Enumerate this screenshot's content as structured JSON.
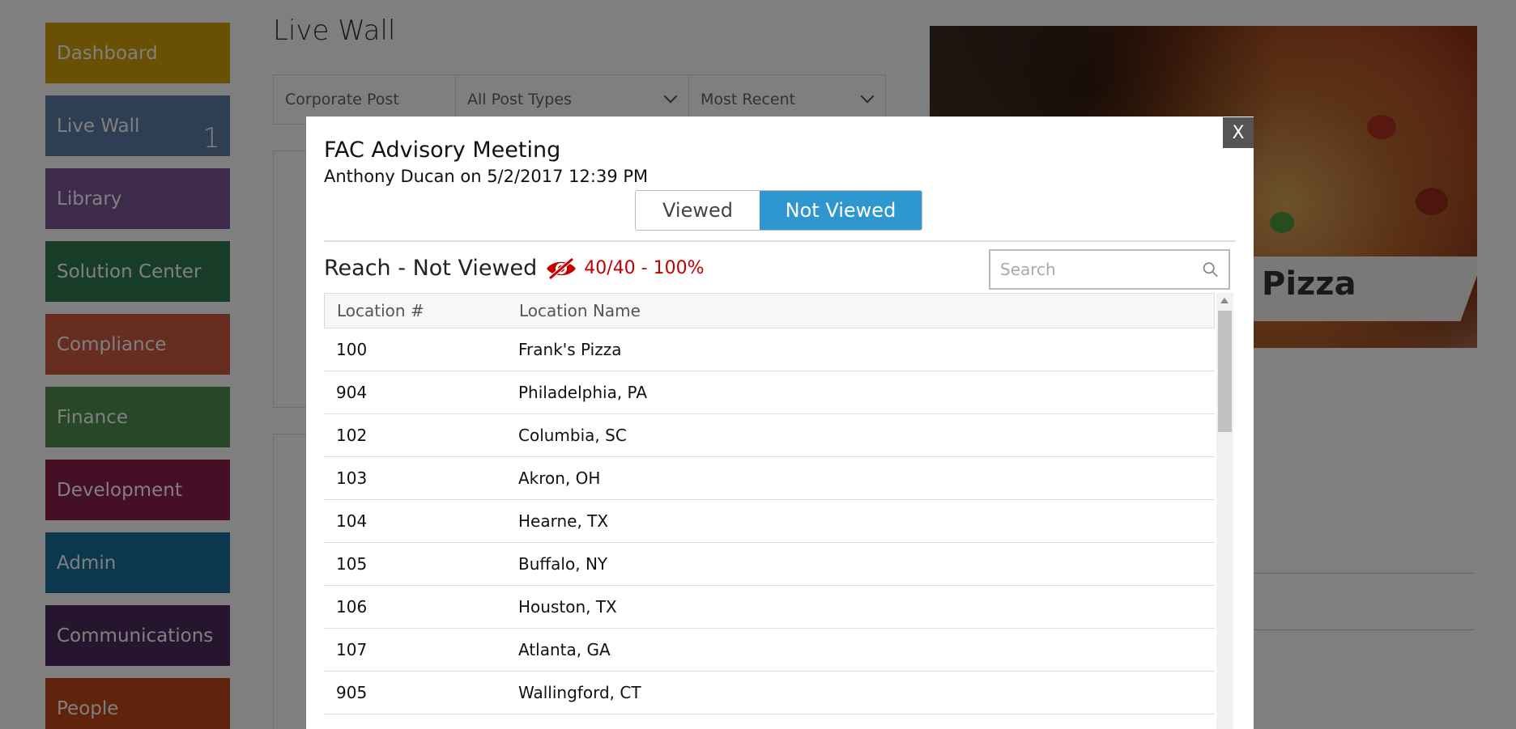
{
  "sidebar": {
    "items": [
      {
        "label": "Dashboard",
        "color": "#d4a10a"
      },
      {
        "label": "Live Wall",
        "color": "#5c7ea6",
        "count": "1"
      },
      {
        "label": "Library",
        "color": "#7d5596"
      },
      {
        "label": "Solution Center",
        "color": "#2f7a52"
      },
      {
        "label": "Compliance",
        "color": "#cc5a40"
      },
      {
        "label": "Finance",
        "color": "#4f8f4f"
      },
      {
        "label": "Development",
        "color": "#8a1f4a"
      },
      {
        "label": "Admin",
        "color": "#1a6e9a"
      },
      {
        "label": "Communications",
        "color": "#4e2a5e"
      },
      {
        "label": "People",
        "color": "#c0481b"
      }
    ]
  },
  "page": {
    "title": "Live Wall",
    "filters": [
      "Corporate Post",
      "All Post Types",
      "Most Recent"
    ],
    "hero_label": "Pizza"
  },
  "modal": {
    "close_label": "X",
    "title": "FAC Advisory Meeting",
    "subtitle": "Anthony Ducan on 5/2/2017 12:39 PM",
    "tabs": {
      "viewed": "Viewed",
      "not_viewed": "Not Viewed",
      "active": "not_viewed"
    },
    "reach_label": "Reach - Not Viewed",
    "reach_value": "40/40 - 100%",
    "reach_icon": "eye-slash-icon",
    "search_placeholder": "Search",
    "columns": [
      "Location #",
      "Location Name"
    ],
    "rows": [
      {
        "num": "100",
        "name": "Frank's Pizza"
      },
      {
        "num": "904",
        "name": "Philadelphia, PA"
      },
      {
        "num": "102",
        "name": "Columbia, SC"
      },
      {
        "num": "103",
        "name": "Akron, OH"
      },
      {
        "num": "104",
        "name": "Hearne, TX"
      },
      {
        "num": "105",
        "name": "Buffalo, NY"
      },
      {
        "num": "106",
        "name": "Houston, TX"
      },
      {
        "num": "107",
        "name": "Atlanta, GA"
      },
      {
        "num": "905",
        "name": "Wallingford, CT"
      }
    ],
    "accent_color": "#2f97cf",
    "alert_color": "#c40000"
  }
}
